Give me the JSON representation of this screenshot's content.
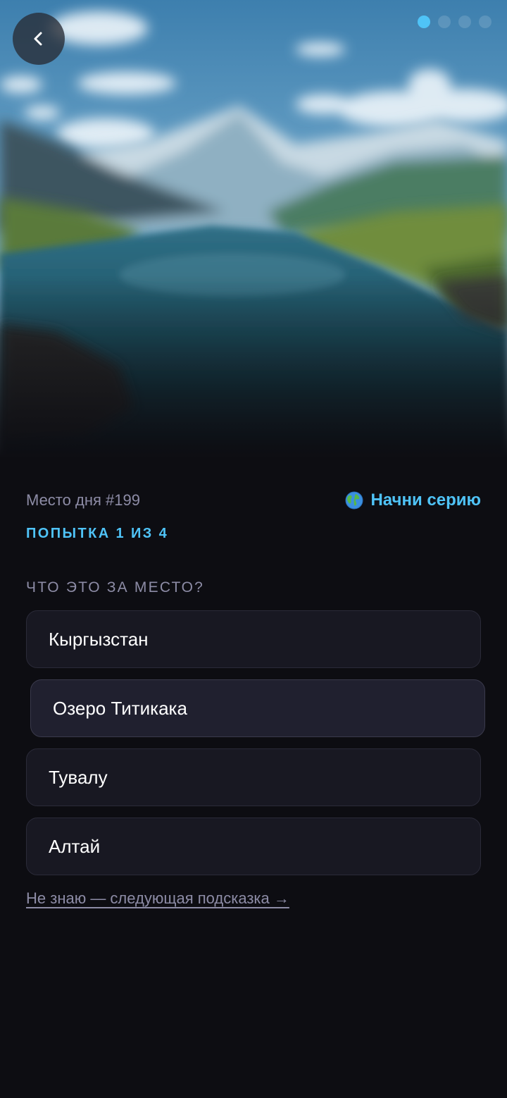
{
  "nav": {
    "back_label": "‹",
    "pager": {
      "total": 4,
      "current": 1
    }
  },
  "header": {
    "place_label": "Место дня #199",
    "streak_icon": "globe-icon",
    "streak_label": "Начни серию",
    "attempt_label": "ПОПЫТКА 1 ИЗ 4"
  },
  "quiz": {
    "question": "ЧТО ЭТО ЗА МЕСТО?",
    "options": [
      {
        "label": "Кыргызстан"
      },
      {
        "label": "Озеро Титикака"
      },
      {
        "label": "Тувалу"
      },
      {
        "label": "Алтай"
      }
    ],
    "skip_label": "Не знаю — следующая подсказка →"
  },
  "colors": {
    "background": "#0d0d12",
    "accent": "#4fc3f7",
    "muted_text": "#8d8ca6",
    "option_bg": "#181822",
    "option_border": "#2a2a38"
  }
}
